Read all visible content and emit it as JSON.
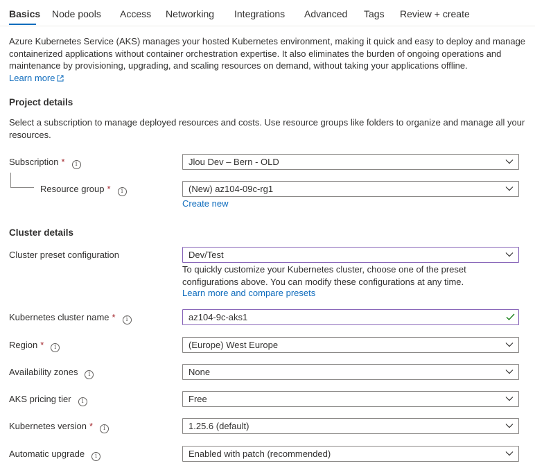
{
  "tabs": [
    {
      "label": "Basics"
    },
    {
      "label": "Node pools"
    },
    {
      "label": "Access"
    },
    {
      "label": "Networking"
    },
    {
      "label": "Integrations"
    },
    {
      "label": "Advanced"
    },
    {
      "label": "Tags"
    },
    {
      "label": "Review + create"
    }
  ],
  "intro": {
    "text": "Azure Kubernetes Service (AKS) manages your hosted Kubernetes environment, making it quick and easy to deploy and manage containerized applications without container orchestration expertise. It also eliminates the burden of ongoing operations and maintenance by provisioning, upgrading, and scaling resources on demand, without taking your applications offline.",
    "learn_more": "Learn more"
  },
  "project": {
    "title": "Project details",
    "description": "Select a subscription to manage deployed resources and costs. Use resource groups like folders to organize and manage all your resources.",
    "subscription_label": "Subscription",
    "subscription_value": "Jlou Dev – Bern - OLD",
    "resource_group_label": "Resource group",
    "resource_group_value": "(New) az104-09c-rg1",
    "create_new": "Create new"
  },
  "cluster": {
    "title": "Cluster details",
    "preset_label": "Cluster preset configuration",
    "preset_value": "Dev/Test",
    "preset_help": "To quickly customize your Kubernetes cluster, choose one of the preset configurations above. You can modify these configurations at any time.",
    "preset_link": "Learn more and compare presets",
    "name_label": "Kubernetes cluster name",
    "name_value": "az104-9c-aks1",
    "region_label": "Region",
    "region_value": "(Europe) West Europe",
    "zones_label": "Availability zones",
    "zones_value": "None",
    "tier_label": "AKS pricing tier",
    "tier_value": "Free",
    "version_label": "Kubernetes version",
    "version_value": "1.25.6 (default)",
    "upgrade_label": "Automatic upgrade",
    "upgrade_value": "Enabled with patch (recommended)"
  },
  "icons": {
    "required": "*",
    "info": "i"
  },
  "colors": {
    "accent": "#0f6cbd",
    "required": "#a4262c",
    "focus_border": "#8764b8",
    "valid": "#107c10"
  }
}
